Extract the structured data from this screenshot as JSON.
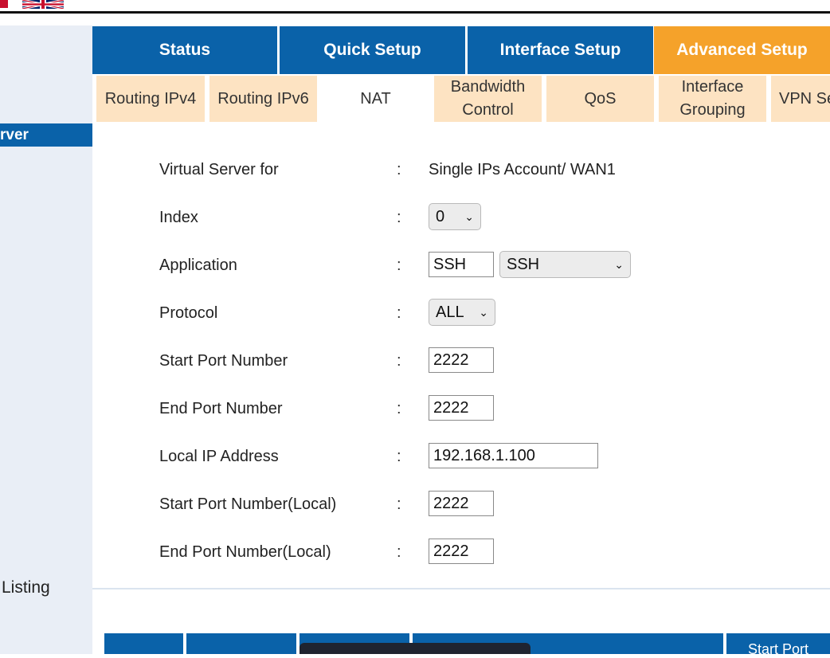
{
  "tabs": [
    {
      "label": "Status"
    },
    {
      "label": "Quick Setup"
    },
    {
      "label": "Interface Setup"
    },
    {
      "label": "Advanced Setup"
    }
  ],
  "subtabs": [
    {
      "label": "Routing IPv4"
    },
    {
      "label": "Routing IPv6"
    },
    {
      "label": "NAT"
    },
    {
      "line1": "Bandwidth",
      "line2": "Control"
    },
    {
      "label": "QoS"
    },
    {
      "line1": "Interface",
      "line2": "Grouping"
    },
    {
      "label": "VPN Se"
    }
  ],
  "sidebar": {
    "selected": "rver",
    "listing": "Listing"
  },
  "form": {
    "virtual_server_label": "Virtual Server for",
    "virtual_server_value": "Single IPs Account/ WAN1",
    "index_label": "Index",
    "index_value": "0",
    "application_label": "Application",
    "application_text": "SSH",
    "application_select": "SSH",
    "protocol_label": "Protocol",
    "protocol_value": "ALL",
    "start_port_label": "Start Port Number",
    "start_port_value": "2222",
    "end_port_label": "End Port Number",
    "end_port_value": "2222",
    "local_ip_label": "Local IP Address",
    "local_ip_value": "192.168.1.100",
    "start_port_local_label": "Start Port Number(Local)",
    "start_port_local_value": "2222",
    "end_port_local_label": "End Port Number(Local)",
    "end_port_local_value": "2222",
    "colon": ":"
  },
  "table_header": {
    "start_port": "Start Port"
  },
  "colors": {
    "primary": "#0a62a9",
    "active_tab": "#f5a22a",
    "subtab_bg": "#fde3c2",
    "sidebar_bg": "#e9eef6"
  }
}
